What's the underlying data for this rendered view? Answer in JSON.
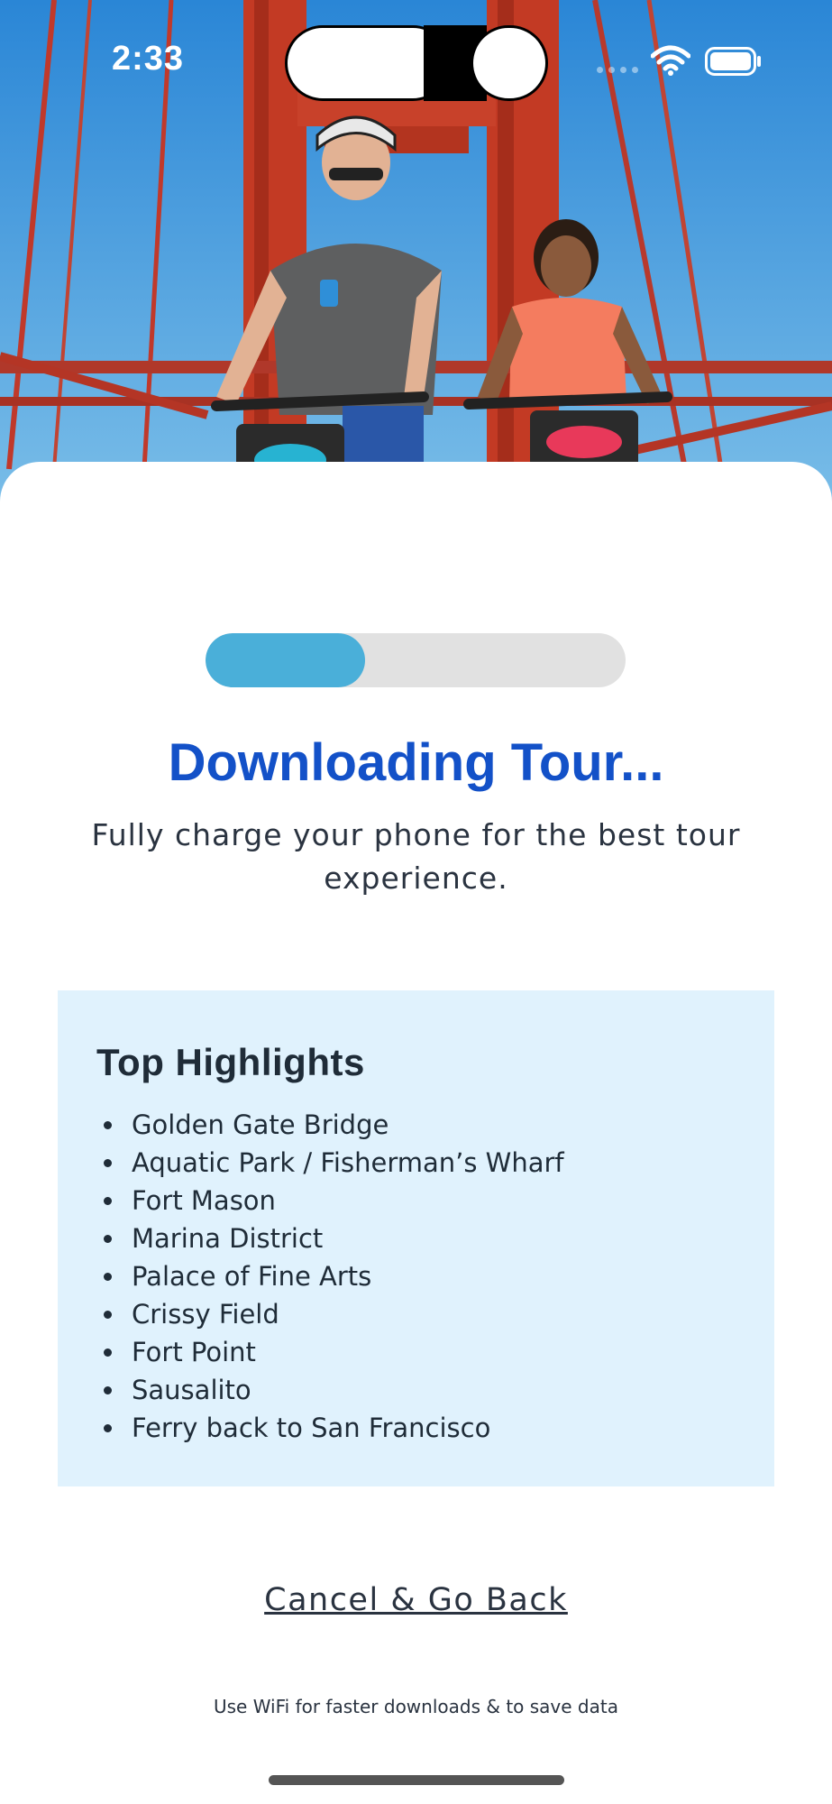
{
  "status_bar": {
    "time": "2:33",
    "icons": [
      "signal-icon",
      "wifi-icon",
      "battery-icon"
    ]
  },
  "hero": {
    "image": "bike-tour-golden-gate-photo"
  },
  "progress": {
    "fraction": 0.38,
    "fill_color": "#4aafd9",
    "track_color": "#e1e1e1"
  },
  "title": "Downloading Tour...",
  "subtitle": "Fully charge your phone for the best tour experience.",
  "highlights": {
    "heading": "Top Highlights",
    "items": [
      "Golden Gate Bridge",
      "Aquatic Park / Fisherman’s Wharf",
      "Fort Mason",
      "Marina District",
      "Palace of Fine Arts",
      "Crissy Field",
      "Fort Point",
      "Sausalito",
      "Ferry back to San Francisco"
    ]
  },
  "cancel_label": "Cancel & Go Back",
  "wifi_note": "Use WiFi for faster downloads & to save data",
  "colors": {
    "title": "#1351c8",
    "highlights_bg": "#e0f2fd",
    "text": "#2a3340"
  }
}
